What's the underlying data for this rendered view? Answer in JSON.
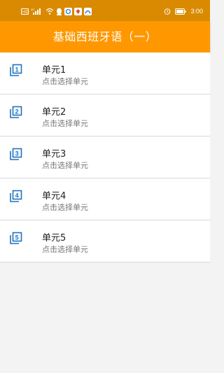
{
  "status_bar": {
    "left_icons": [
      "hd-icon",
      "signal-icon",
      "wifi-icon",
      "qq-icon",
      "app-icon-1",
      "app-icon-2",
      "app-icon-3"
    ],
    "time": "3:00"
  },
  "app_bar": {
    "title": "基础西班牙语（一）",
    "background": "#ff9800"
  },
  "units": [
    {
      "number": "1",
      "title": "单元1",
      "subtitle": "点击选择单元"
    },
    {
      "number": "2",
      "title": "单元2",
      "subtitle": "点击选择单元"
    },
    {
      "number": "3",
      "title": "单元3",
      "subtitle": "点击选择单元"
    },
    {
      "number": "4",
      "title": "单元4",
      "subtitle": "点击选择单元"
    },
    {
      "number": "5",
      "title": "单元5",
      "subtitle": "点击选择单元"
    }
  ],
  "colors": {
    "accent": "#ff9800",
    "icon": "#1e73be"
  }
}
